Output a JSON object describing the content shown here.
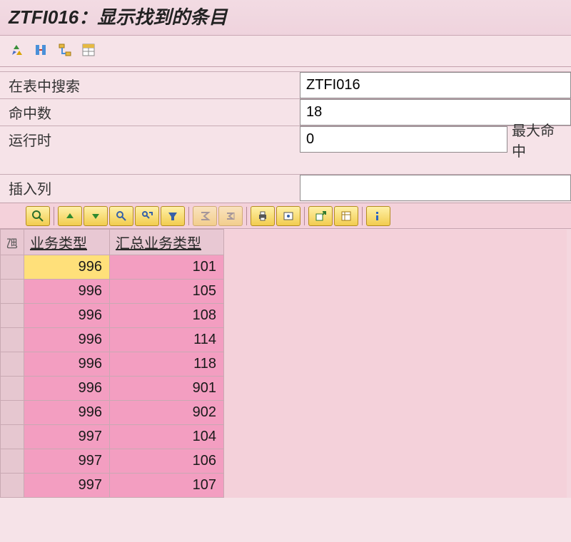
{
  "title": "ZTFI016：显示找到的条目",
  "app_toolbar": {
    "icons": [
      "recycle-icon",
      "compare-icon",
      "flow-icon",
      "spreadsheet-icon"
    ]
  },
  "form": {
    "search_label": "在表中搜索",
    "search_value": "ZTFI016",
    "hits_label": "命中数",
    "hits_value": "18",
    "runtime_label": "运行时",
    "runtime_value": "0",
    "max_hits_label": "最大命中",
    "insert_col_label": "插入列",
    "insert_col_value": ""
  },
  "alv_toolbar": {
    "buttons": [
      "details-icon",
      "sort-asc-icon",
      "sort-desc-icon",
      "find-icon",
      "find-next-icon",
      "filter-icon",
      "sum-icon",
      "subtotal-icon",
      "print-icon",
      "view-icon",
      "export-icon",
      "layout-icon",
      "info-icon"
    ]
  },
  "grid": {
    "corner": "乪",
    "columns": [
      "业务类型",
      "汇总业务类型"
    ],
    "selected_cell": [
      0,
      0
    ],
    "rows": [
      [
        "996",
        "101"
      ],
      [
        "996",
        "105"
      ],
      [
        "996",
        "108"
      ],
      [
        "996",
        "114"
      ],
      [
        "996",
        "118"
      ],
      [
        "996",
        "901"
      ],
      [
        "996",
        "902"
      ],
      [
        "997",
        "104"
      ],
      [
        "997",
        "106"
      ],
      [
        "997",
        "107"
      ]
    ]
  }
}
